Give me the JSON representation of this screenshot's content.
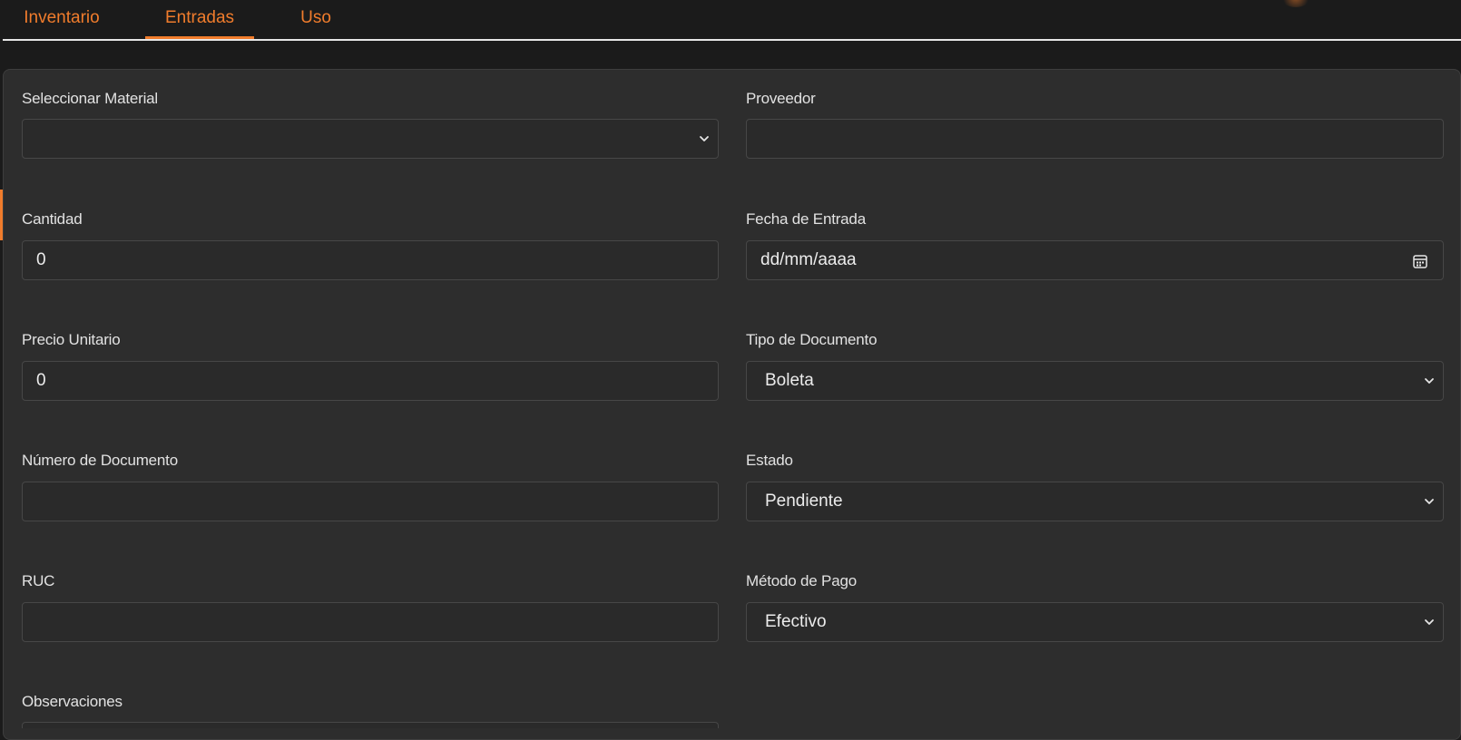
{
  "tabs": [
    {
      "label": "Inventario",
      "active": false
    },
    {
      "label": "Entradas",
      "active": true
    },
    {
      "label": "Uso",
      "active": false
    }
  ],
  "accent_color": "#f07c2c",
  "form": {
    "material": {
      "label": "Seleccionar Material",
      "value": ""
    },
    "proveedor": {
      "label": "Proveedor",
      "value": ""
    },
    "cantidad": {
      "label": "Cantidad",
      "value": "0"
    },
    "fecha": {
      "label": "Fecha de Entrada",
      "placeholder": "dd/mm/aaaa"
    },
    "precio": {
      "label": "Precio Unitario",
      "value": "0"
    },
    "tipo_documento": {
      "label": "Tipo de Documento",
      "value": "Boleta"
    },
    "numero_documento": {
      "label": "Número de Documento",
      "value": ""
    },
    "estado": {
      "label": "Estado",
      "value": "Pendiente"
    },
    "ruc": {
      "label": "RUC",
      "value": ""
    },
    "metodo_pago": {
      "label": "Método de Pago",
      "value": "Efectivo"
    },
    "observaciones": {
      "label": "Observaciones",
      "value": ""
    }
  },
  "icons": {
    "select_arrow": "chevron-down-icon",
    "date_picker": "calendar-icon"
  }
}
